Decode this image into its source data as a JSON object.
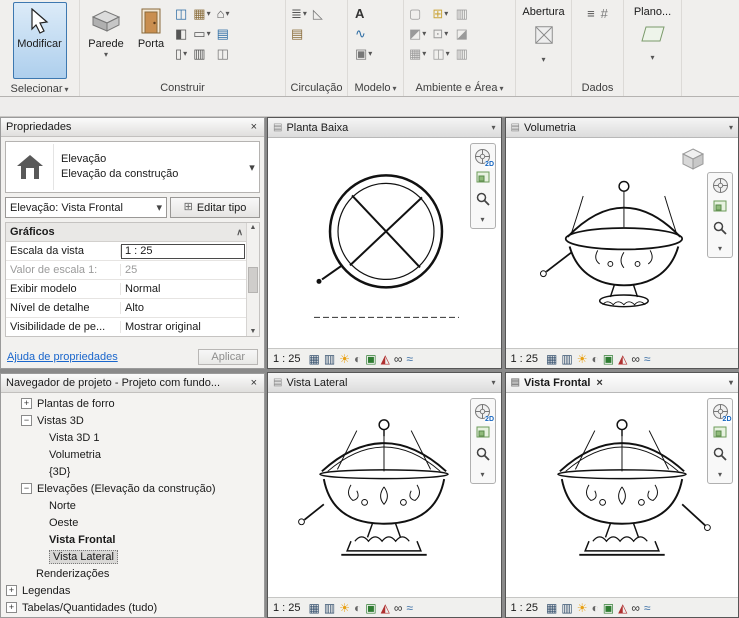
{
  "ribbon": {
    "modificar": "Modificar",
    "selecionar": "Selecionar",
    "parede": "Parede",
    "porta": "Porta",
    "construir": "Construir",
    "circulacao": "Circulação",
    "modelo": "Modelo",
    "ambiente_area": "Ambiente e Área",
    "abertura": "Abertura",
    "dados": "Dados",
    "plano": "Plano..."
  },
  "properties": {
    "title": "Propriedades",
    "family": "Elevação",
    "type": "Elevação da construção",
    "selector": "Elevação: Vista Frontal",
    "edit_type": "Editar tipo",
    "section": "Gráficos",
    "rows": [
      {
        "label": "Escala da vista",
        "value": "1 : 25"
      },
      {
        "label": "Valor de escala 1:",
        "value": "25"
      },
      {
        "label": "Exibir modelo",
        "value": "Normal"
      },
      {
        "label": "Nível de detalhe",
        "value": "Alto"
      },
      {
        "label": "Visibilidade de pe...",
        "value": "Mostrar original"
      }
    ],
    "help": "Ajuda de propriedades",
    "apply": "Aplicar"
  },
  "browser": {
    "title": "Navegador de projeto - Projeto com fundo...",
    "items": [
      {
        "label": "Plantas de forro"
      },
      {
        "label": "Vistas 3D"
      },
      {
        "label": "Vista 3D 1"
      },
      {
        "label": "Volumetria"
      },
      {
        "label": "{3D}"
      },
      {
        "label": "Elevações (Elevação da construção)"
      },
      {
        "label": "Norte"
      },
      {
        "label": "Oeste"
      },
      {
        "label": "Vista Frontal"
      },
      {
        "label": "Vista Lateral"
      },
      {
        "label": "Renderizações"
      },
      {
        "label": "Legendas"
      },
      {
        "label": "Tabelas/Quantidades (tudo)"
      }
    ]
  },
  "viewports": [
    {
      "title": "Planta Baixa",
      "scale": "1 : 25"
    },
    {
      "title": "Volumetria",
      "scale": "1 : 25"
    },
    {
      "title": "Vista Lateral",
      "scale": "1 : 25"
    },
    {
      "title": "Vista Frontal",
      "scale": "1 : 25"
    }
  ],
  "nav": {
    "wheel_label": "2D"
  },
  "view_controls": {
    "glyphs": [
      "▦",
      "▥",
      "☀",
      "◐",
      "▣",
      "◭",
      "∞",
      "≈"
    ]
  },
  "icons": {
    "dropdown": "▾",
    "close": "×",
    "plus": "+",
    "minus": "−",
    "chevron_up": "∧",
    "doc": "▤",
    "window": "◫",
    "component": "▦",
    "roof": "⌂",
    "ceiling": "◧",
    "floor": "▭",
    "curtain_system": "▤",
    "column": "▯",
    "curtain_grid": "▥",
    "mullion": "◫",
    "railing": "≣",
    "ramp": "◺",
    "stair": "▤",
    "model_text": "A",
    "model_line": "∿",
    "model_group": "▣",
    "room": "▢",
    "room_separator": "▥",
    "room_tag": "⊞",
    "area": "◩",
    "area_boundary": "◪",
    "area_tag": "⊡",
    "level": "≡",
    "grid_axis": "#",
    "edit_type_glyph": "⊞"
  }
}
